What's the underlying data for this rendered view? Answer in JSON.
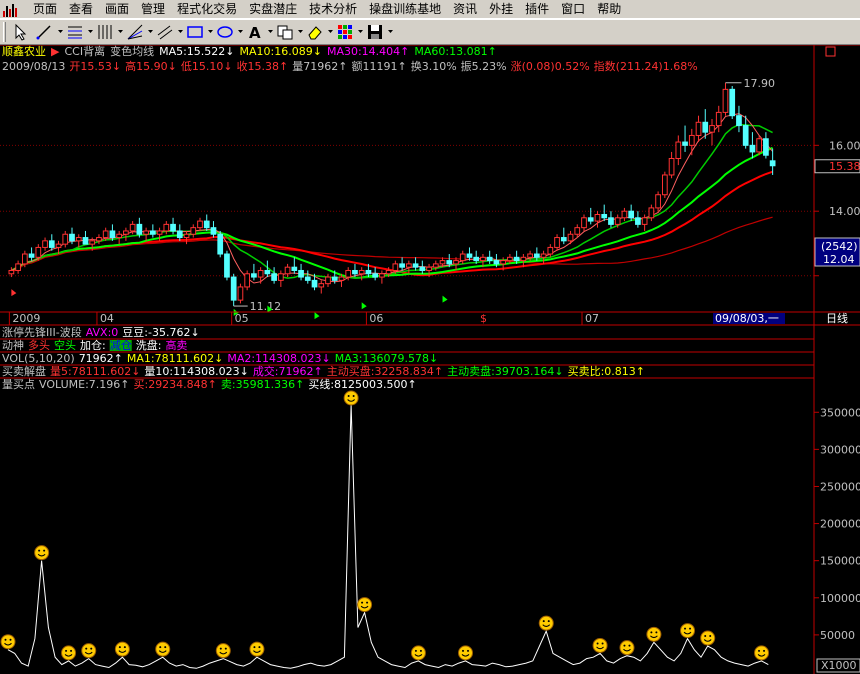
{
  "menu": [
    "页面",
    "查看",
    "画面",
    "管理",
    "程式化交易",
    "实盘潜庄",
    "技术分析",
    "操盘训练基地",
    "资讯",
    "外挂",
    "插件",
    "窗口",
    "帮助"
  ],
  "toolbar_icons": [
    "cursor-icon",
    "line-tool-icon",
    "fib-icon",
    "period-lines-icon",
    "fan-icon",
    "channel-icon",
    "rectangle-icon",
    "ellipse-icon",
    "text-icon",
    "copy-icon",
    "eraser-icon",
    "grid-icon",
    "save-icon"
  ],
  "colors": {
    "up": "#ff3232",
    "down": "#54ffff",
    "ma5": "#ffffff",
    "ma10": "#ffff00",
    "ma30": "#ff00ff",
    "ma60": "#00ff00",
    "grid": "#800000",
    "axis": "#c00000",
    "vol_line": "#ffffff"
  },
  "header": {
    "stock_name": "顺鑫农业",
    "indicator": "CCI背离",
    "ma_label": "变色均线",
    "ma5": "MA5:15.522↓",
    "ma10": "MA10:16.089↓",
    "ma30": "MA30:14.404↑",
    "ma60": "MA60:13.081↑"
  },
  "quote": {
    "date": "2009/08/13",
    "open": "开15.53↓",
    "high": "高15.90↓",
    "low": "低15.10↓",
    "close": "收15.38↑",
    "volume": "量71962↑",
    "amount": "额11191↑",
    "turnover": "换3.10%",
    "amplitude": "振5.23%",
    "change": "涨(0.08)0.52%",
    "index": "指数(211.24)1.68%"
  },
  "price_axis": {
    "labels": [
      "16.00",
      "14.00",
      "12.04"
    ],
    "current": "15.38",
    "high_mark": "17.90",
    "low_mark": "11.12",
    "box_top": "(2542)",
    "box_val": "12.04"
  },
  "time_axis": {
    "labels": [
      "2009",
      "04",
      "05",
      "06",
      "07"
    ],
    "selected": "09/08/03,一",
    "period": "日线"
  },
  "ind1": {
    "name": "涨停先锋III-波段",
    "avx": "AVX:0",
    "dd": "豆豆:-35.762↓"
  },
  "ind2": {
    "name": "动神",
    "duo": "多头",
    "kong": "空头",
    "jiacang": "加仓:",
    "jiancang": "减仓",
    "xipan": "洗盘:",
    "gaomai": "高卖"
  },
  "ind3": {
    "name": "VOL(5,10,20)",
    "v": "71962↑",
    "ma1": "MA1:78111.602↓",
    "ma2": "MA2:114308.023↓",
    "ma3": "MA3:136079.578↓"
  },
  "ind4": {
    "name": "买卖解盘",
    "l5": "量5:78111.602↓",
    "l10": "量10:114308.023↓",
    "cj": "成交:71962↑",
    "zdmr": "主动买盘:32258.834↑",
    "zdmc": "主动卖盘:39703.164↓",
    "mmb": "买卖比:0.813↑"
  },
  "ind5": {
    "name": "量买点",
    "volume": "VOLUME:7.196↑",
    "buy": "买:29234.848↑",
    "sell": "卖:35981.336↑",
    "line": "买线:8125003.500↑"
  },
  "vol_axis": {
    "labels": [
      "350000",
      "300000",
      "250000",
      "200000",
      "150000",
      "100000",
      "50000"
    ],
    "unit": "X1000"
  },
  "chart_data": {
    "type": "candlestick",
    "title": "",
    "xlabel": "",
    "ylabel": "",
    "ylim": [
      11.0,
      18.5
    ],
    "sessions": 160,
    "candles": [
      [
        12.1,
        12.3,
        12.0,
        12.2
      ],
      [
        12.2,
        12.5,
        12.1,
        12.4
      ],
      [
        12.4,
        12.8,
        12.3,
        12.7
      ],
      [
        12.7,
        12.9,
        12.5,
        12.6
      ],
      [
        12.6,
        13.0,
        12.5,
        12.9
      ],
      [
        12.9,
        13.2,
        12.8,
        13.1
      ],
      [
        13.1,
        13.3,
        12.8,
        12.9
      ],
      [
        12.9,
        13.1,
        12.7,
        13.0
      ],
      [
        13.0,
        13.4,
        12.9,
        13.3
      ],
      [
        13.3,
        13.5,
        13.0,
        13.1
      ],
      [
        13.1,
        13.3,
        12.9,
        13.2
      ],
      [
        13.2,
        13.4,
        13.0,
        13.0
      ],
      [
        13.0,
        13.2,
        12.8,
        13.1
      ],
      [
        13.1,
        13.3,
        13.0,
        13.2
      ],
      [
        13.2,
        13.5,
        13.1,
        13.4
      ],
      [
        13.4,
        13.6,
        13.1,
        13.2
      ],
      [
        13.2,
        13.4,
        13.0,
        13.3
      ],
      [
        13.3,
        13.5,
        13.1,
        13.4
      ],
      [
        13.4,
        13.7,
        13.3,
        13.6
      ],
      [
        13.6,
        13.8,
        13.2,
        13.3
      ],
      [
        13.3,
        13.5,
        13.1,
        13.4
      ],
      [
        13.4,
        13.6,
        13.2,
        13.3
      ],
      [
        13.3,
        13.5,
        13.1,
        13.4
      ],
      [
        13.4,
        13.7,
        13.3,
        13.6
      ],
      [
        13.6,
        13.8,
        13.3,
        13.4
      ],
      [
        13.4,
        13.6,
        13.1,
        13.2
      ],
      [
        13.2,
        13.4,
        13.0,
        13.3
      ],
      [
        13.3,
        13.6,
        13.2,
        13.5
      ],
      [
        13.5,
        13.8,
        13.4,
        13.7
      ],
      [
        13.7,
        13.9,
        13.4,
        13.5
      ],
      [
        13.5,
        13.7,
        13.2,
        13.3
      ],
      [
        13.3,
        13.4,
        12.6,
        12.7
      ],
      [
        12.7,
        12.8,
        11.9,
        12.0
      ],
      [
        12.0,
        12.1,
        11.12,
        11.3
      ],
      [
        11.3,
        11.8,
        11.2,
        11.7
      ],
      [
        11.7,
        12.2,
        11.6,
        12.1
      ],
      [
        12.1,
        12.4,
        11.9,
        12.0
      ],
      [
        12.0,
        12.3,
        11.8,
        12.2
      ],
      [
        12.2,
        12.5,
        12.0,
        12.1
      ],
      [
        12.1,
        12.3,
        11.8,
        11.9
      ],
      [
        11.9,
        12.2,
        11.7,
        12.1
      ],
      [
        12.1,
        12.4,
        12.0,
        12.3
      ],
      [
        12.3,
        12.6,
        12.1,
        12.2
      ],
      [
        12.2,
        12.4,
        11.9,
        12.0
      ],
      [
        12.0,
        12.2,
        11.8,
        11.9
      ],
      [
        11.9,
        12.1,
        11.6,
        11.7
      ],
      [
        11.7,
        11.9,
        11.5,
        11.8
      ],
      [
        11.8,
        12.1,
        11.7,
        12.0
      ],
      [
        12.0,
        12.2,
        11.8,
        11.9
      ],
      [
        11.9,
        12.1,
        11.7,
        12.0
      ],
      [
        12.0,
        12.3,
        11.9,
        12.2
      ],
      [
        12.2,
        12.4,
        12.0,
        12.1
      ],
      [
        12.1,
        12.3,
        11.9,
        12.2
      ],
      [
        12.2,
        12.4,
        12.0,
        12.1
      ],
      [
        12.1,
        12.3,
        11.9,
        12.0
      ],
      [
        12.0,
        12.2,
        11.8,
        12.1
      ],
      [
        12.1,
        12.3,
        12.0,
        12.2
      ],
      [
        12.2,
        12.5,
        12.1,
        12.4
      ],
      [
        12.4,
        12.6,
        12.2,
        12.3
      ],
      [
        12.3,
        12.5,
        12.1,
        12.4
      ],
      [
        12.4,
        12.6,
        12.2,
        12.3
      ],
      [
        12.3,
        12.5,
        12.1,
        12.2
      ],
      [
        12.2,
        12.4,
        12.0,
        12.3
      ],
      [
        12.3,
        12.5,
        12.2,
        12.4
      ],
      [
        12.4,
        12.6,
        12.3,
        12.5
      ],
      [
        12.5,
        12.7,
        12.3,
        12.4
      ],
      [
        12.4,
        12.6,
        12.2,
        12.5
      ],
      [
        12.5,
        12.8,
        12.4,
        12.7
      ],
      [
        12.7,
        12.9,
        12.5,
        12.6
      ],
      [
        12.6,
        12.8,
        12.4,
        12.5
      ],
      [
        12.5,
        12.7,
        12.3,
        12.6
      ],
      [
        12.6,
        12.8,
        12.4,
        12.5
      ],
      [
        12.5,
        12.7,
        12.3,
        12.4
      ],
      [
        12.4,
        12.6,
        12.2,
        12.5
      ],
      [
        12.5,
        12.7,
        12.4,
        12.6
      ],
      [
        12.6,
        12.8,
        12.4,
        12.5
      ],
      [
        12.5,
        12.7,
        12.3,
        12.6
      ],
      [
        12.6,
        12.8,
        12.5,
        12.7
      ],
      [
        12.7,
        12.9,
        12.5,
        12.6
      ],
      [
        12.6,
        12.8,
        12.4,
        12.7
      ],
      [
        12.7,
        13.0,
        12.6,
        12.9
      ],
      [
        12.9,
        13.3,
        12.8,
        13.2
      ],
      [
        13.2,
        13.5,
        13.0,
        13.1
      ],
      [
        13.1,
        13.4,
        13.0,
        13.3
      ],
      [
        13.3,
        13.6,
        13.2,
        13.5
      ],
      [
        13.5,
        13.9,
        13.4,
        13.8
      ],
      [
        13.8,
        14.1,
        13.6,
        13.7
      ],
      [
        13.7,
        14.0,
        13.5,
        13.9
      ],
      [
        13.9,
        14.2,
        13.7,
        13.8
      ],
      [
        13.8,
        14.0,
        13.5,
        13.6
      ],
      [
        13.6,
        13.9,
        13.5,
        13.8
      ],
      [
        13.8,
        14.1,
        13.7,
        14.0
      ],
      [
        14.0,
        14.2,
        13.7,
        13.8
      ],
      [
        13.8,
        14.0,
        13.5,
        13.6
      ],
      [
        13.6,
        13.9,
        13.4,
        13.8
      ],
      [
        13.8,
        14.2,
        13.7,
        14.1
      ],
      [
        14.1,
        14.6,
        14.0,
        14.5
      ],
      [
        14.5,
        15.2,
        14.4,
        15.1
      ],
      [
        15.1,
        15.8,
        15.0,
        15.6
      ],
      [
        15.6,
        16.3,
        15.4,
        16.1
      ],
      [
        16.1,
        16.6,
        15.8,
        16.0
      ],
      [
        16.0,
        16.5,
        15.7,
        16.3
      ],
      [
        16.3,
        16.9,
        16.1,
        16.7
      ],
      [
        16.7,
        17.1,
        16.2,
        16.4
      ],
      [
        16.4,
        16.8,
        16.0,
        16.6
      ],
      [
        16.6,
        17.2,
        16.4,
        17.0
      ],
      [
        17.0,
        17.9,
        16.9,
        17.7
      ],
      [
        17.7,
        17.8,
        16.8,
        16.9
      ],
      [
        16.9,
        17.2,
        16.4,
        16.6
      ],
      [
        16.6,
        16.9,
        15.9,
        16.0
      ],
      [
        16.0,
        16.4,
        15.6,
        15.8
      ],
      [
        15.8,
        16.3,
        15.7,
        16.2
      ],
      [
        16.2,
        16.4,
        15.6,
        15.7
      ],
      [
        15.53,
        15.9,
        15.1,
        15.38
      ]
    ],
    "volume_series": {
      "name": "",
      "scale": "X1000",
      "ylim": [
        0,
        380000
      ],
      "values": [
        30000,
        25000,
        12000,
        8000,
        45000,
        150000,
        60000,
        20000,
        10000,
        15000,
        8000,
        12000,
        18000,
        10000,
        8000,
        6000,
        12000,
        20000,
        10000,
        9000,
        7000,
        10000,
        15000,
        20000,
        12000,
        8000,
        10000,
        6000,
        5000,
        8000,
        12000,
        15000,
        18000,
        14000,
        10000,
        8000,
        12000,
        20000,
        15000,
        10000,
        8000,
        6000,
        5000,
        7000,
        10000,
        12000,
        9000,
        8000,
        10000,
        15000,
        20000,
        360000,
        60000,
        80000,
        40000,
        20000,
        15000,
        10000,
        8000,
        6000,
        12000,
        15000,
        10000,
        8000,
        6000,
        10000,
        8000,
        12000,
        15000,
        10000,
        9000,
        8000,
        12000,
        10000,
        7000,
        8000,
        10000,
        12000,
        15000,
        35000,
        55000,
        25000,
        20000,
        15000,
        10000,
        12000,
        18000,
        20000,
        25000,
        15000,
        12000,
        18000,
        22000,
        20000,
        15000,
        25000,
        40000,
        30000,
        20000,
        15000,
        25000,
        45000,
        30000,
        20000,
        35000,
        30000,
        20000,
        15000,
        12000,
        10000,
        8000,
        12000,
        15000,
        10000
      ]
    }
  }
}
